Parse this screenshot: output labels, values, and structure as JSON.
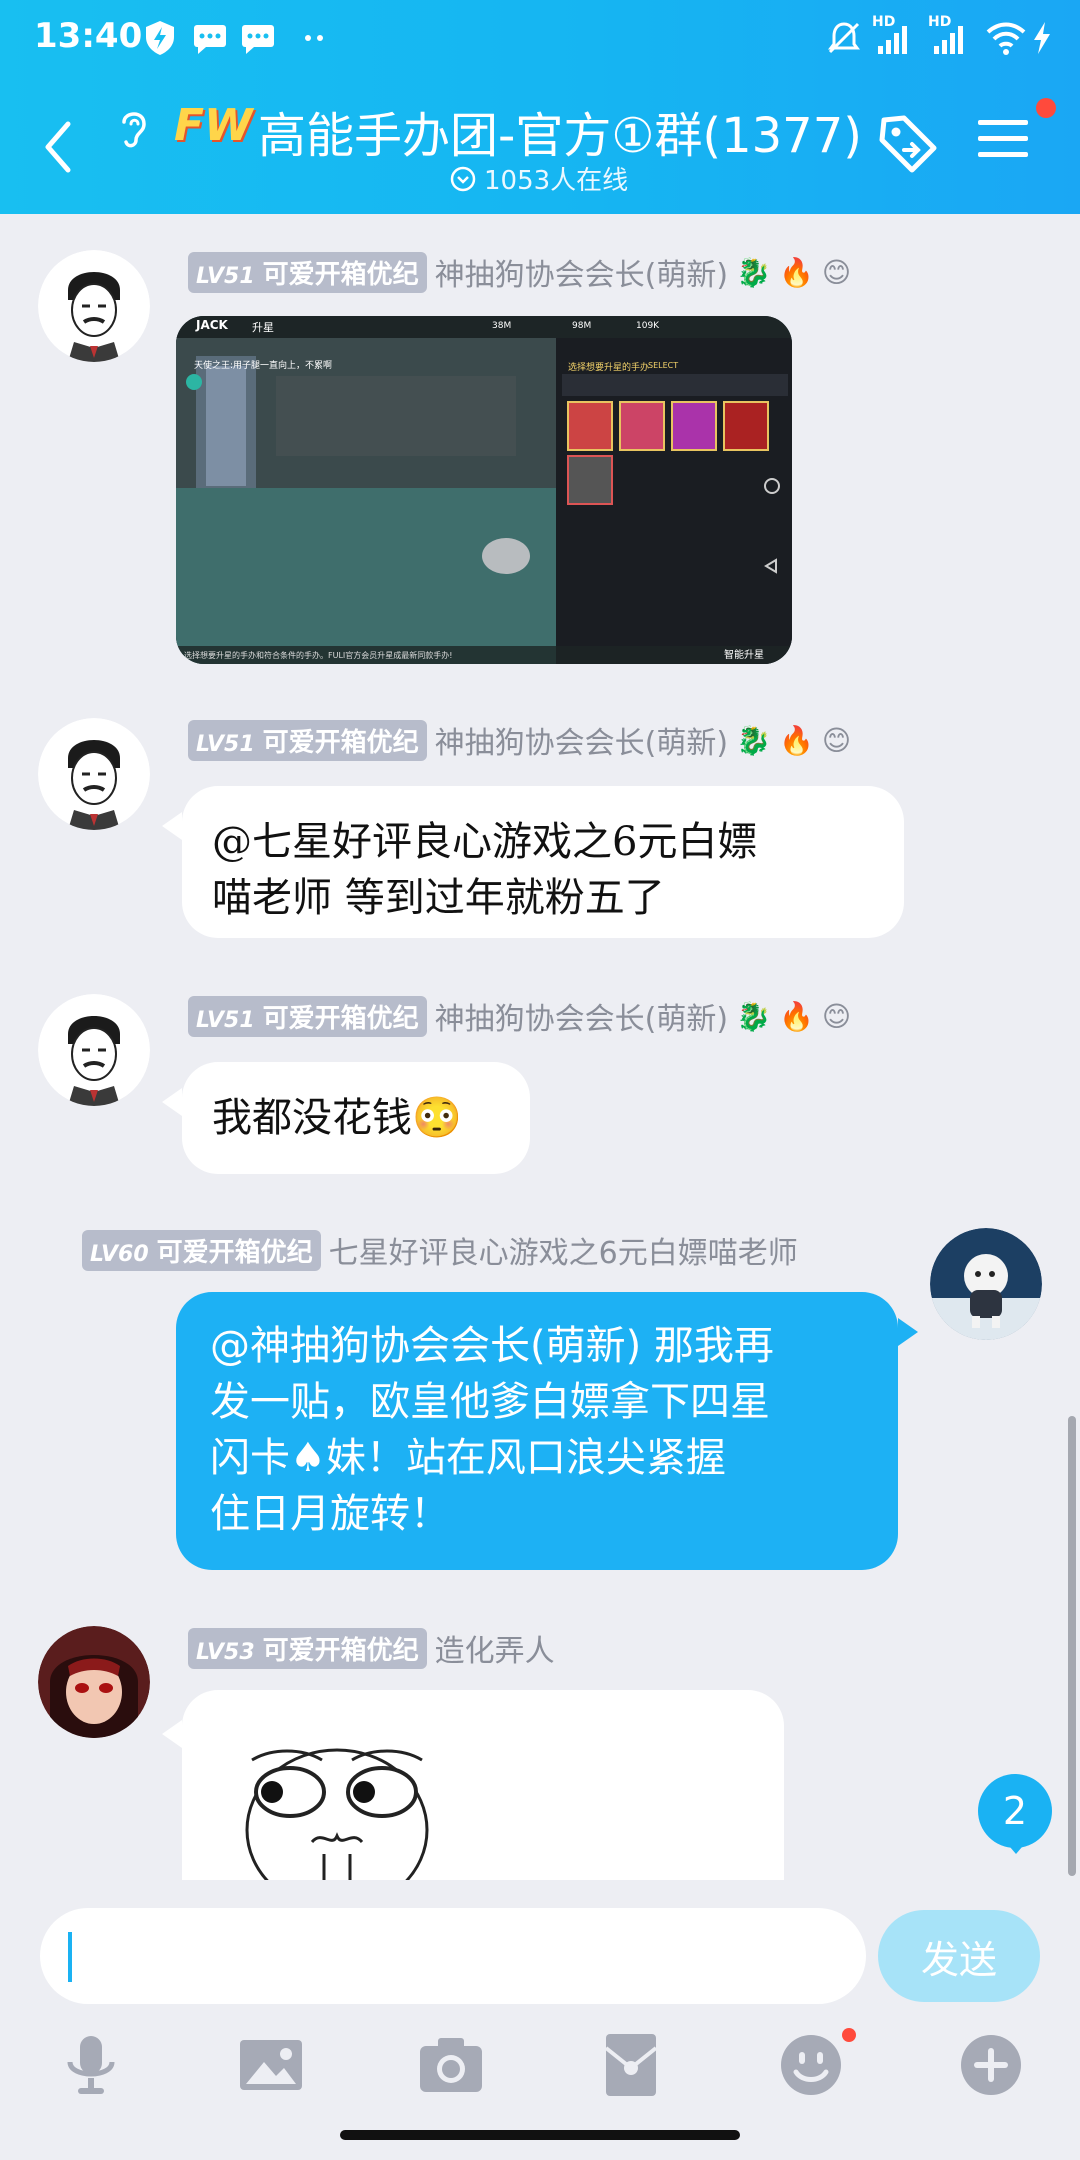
{
  "status_bar": {
    "time": "13:40",
    "icons": [
      "shield-bolt-icon",
      "chat-icon",
      "chat-icon",
      "more-dots-icon",
      "mute-bell-icon",
      "hd-signal-icon",
      "hd-signal-icon",
      "wifi-icon",
      "charging-icon"
    ],
    "hd1": "HD",
    "hd2": "HD"
  },
  "header": {
    "logo_text": "FW",
    "title": "高能手办团-官方①群(1377)",
    "online": "1053人在线",
    "accent_color": "#18bff1"
  },
  "messages": [
    {
      "level": "LV51",
      "tag": "可爱开箱优纪",
      "name": "神抽狗协会会长(萌新)",
      "type": "image",
      "image": {
        "top_brand": "JACK",
        "top_tab": "升星",
        "stat1": "38M",
        "stat2": "98M",
        "stat3": "109K",
        "banner": "天使之王:用子腿一直向上，不累啊",
        "panel_title": "选择想要升星的手办",
        "panel_sub": "SELECT",
        "bottom_tip": "选择想要升星的手办和符合条件的手办。FULI官方会员升星成最新同款手办!",
        "bottom_right": "智能升星"
      }
    },
    {
      "level": "LV51",
      "tag": "可爱开箱优纪",
      "name": "神抽狗协会会长(萌新)",
      "type": "text",
      "lines": [
        "@七星好评良心游戏之6元白嫖",
        "喵老师 等到过年就粉五了"
      ]
    },
    {
      "level": "LV51",
      "tag": "可爱开箱优纪",
      "name": "神抽狗协会会长(萌新)",
      "type": "text",
      "lines": [
        "我都没花钱😳"
      ]
    },
    {
      "level": "LV60",
      "tag": "可爱开箱优纪",
      "name": "七星好评良心游戏之6元白嫖喵老师",
      "type": "text-self",
      "lines": [
        "@神抽狗协会会长(萌新) 那我再",
        "发一贴，欧皇他爹白嫖拿下四星",
        "闪卡♠妹！站在风口浪尖紧握",
        "住日月旋转！"
      ]
    },
    {
      "level": "LV53",
      "tag": "可爱开箱优纪",
      "name": "造化弄人",
      "type": "sticker"
    }
  ],
  "unread_badge": "2",
  "input": {
    "placeholder": "",
    "send_label": "发送"
  },
  "toolbar": [
    "microphone-icon",
    "image-icon",
    "camera-icon",
    "red-packet-icon",
    "emoji-icon",
    "plus-icon"
  ]
}
